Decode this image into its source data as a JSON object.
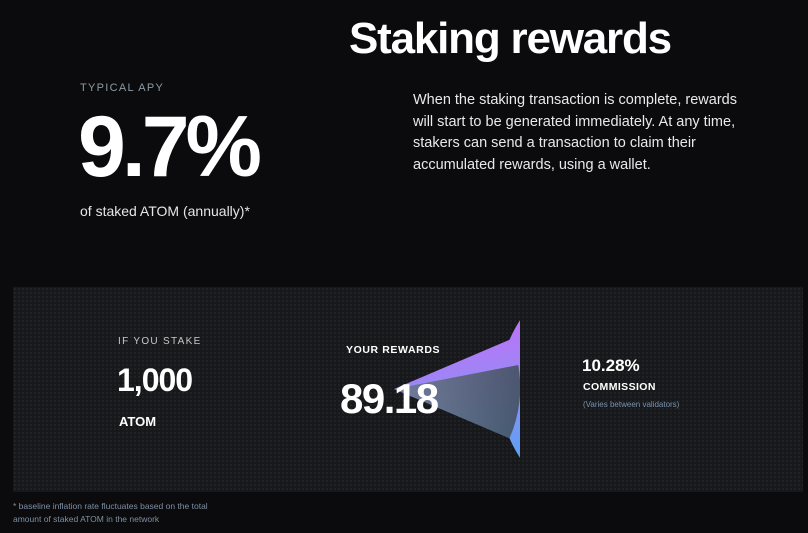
{
  "header": {
    "title": "Staking rewards"
  },
  "apy": {
    "label": "TYPICAL APY",
    "value": "9.7%",
    "sublabel": "of staked ATOM (annually)*"
  },
  "description": "When the staking transaction is complete, rewards will start to be generated immediately. At any time, stakers can send a transaction to claim their accumulated rewards, using a wallet.",
  "calculator": {
    "stake_label": "IF YOU STAKE",
    "stake_amount": "1,000",
    "stake_unit": "ATOM",
    "rewards_label": "YOUR REWARDS",
    "rewards_value": "89.18",
    "commission_value": "10.28%",
    "commission_label": "COMMISSION",
    "commission_note": "(Varies between validators)"
  },
  "footnote": "* baseline inflation rate fluctuates based on the total amount of staked ATOM in the network",
  "colors": {
    "background": "#0b0b0d",
    "panel": "#17181b",
    "pie_top": "#e25cf6",
    "pie_bottom": "#23b4f2",
    "commission_slice": "#4a5966",
    "muted_text": "#7e8fa3"
  }
}
